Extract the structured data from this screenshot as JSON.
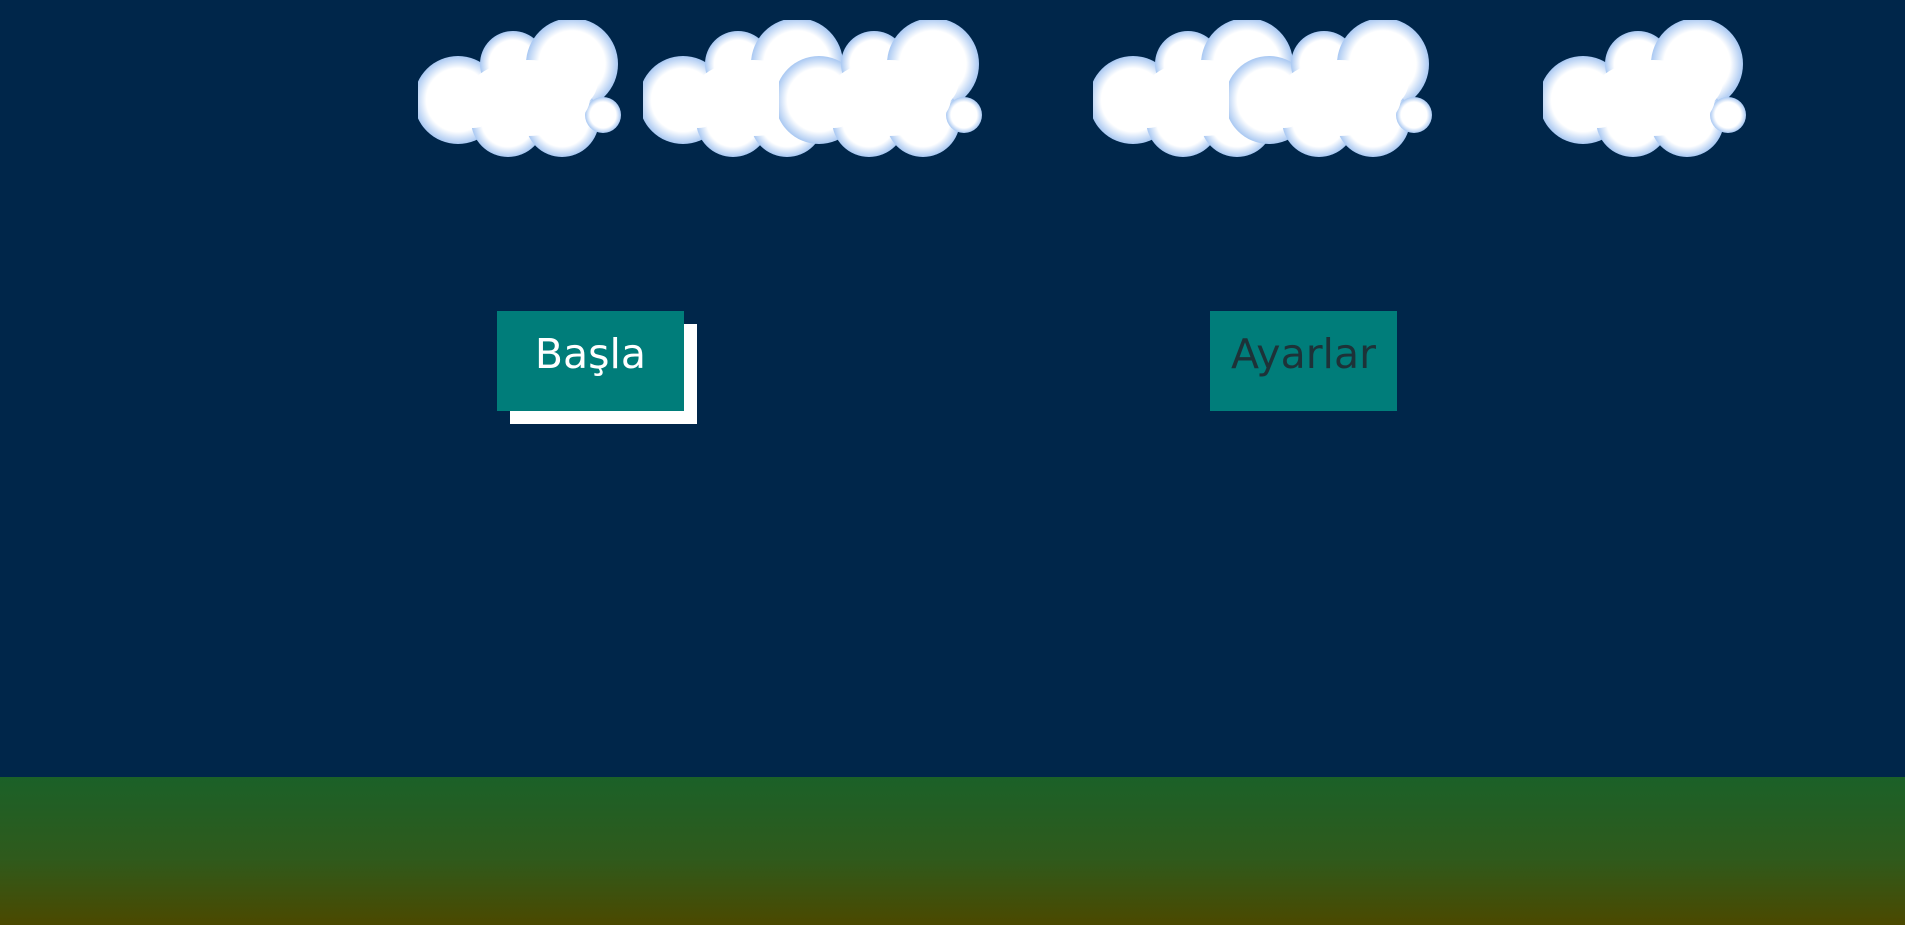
{
  "scene": {
    "sky_color": "#00264a",
    "ground_gradient": [
      "#1b6128",
      "#4b4900"
    ],
    "cloud_count": 6,
    "clouds": [
      {
        "name": "cloud-1"
      },
      {
        "name": "cloud-2"
      },
      {
        "name": "cloud-3"
      },
      {
        "name": "cloud-4"
      },
      {
        "name": "cloud-5"
      },
      {
        "name": "cloud-6"
      }
    ]
  },
  "menu": {
    "start_label": "Başla",
    "settings_label": "Ayarlar",
    "button_color": "#007d7a",
    "start_text_color": "#ffffff",
    "settings_text_color": "#1d3238"
  }
}
